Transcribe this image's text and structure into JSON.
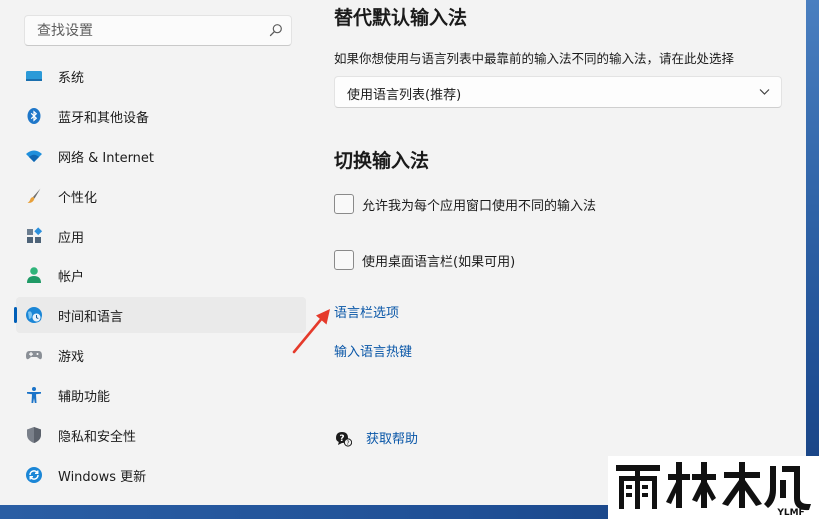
{
  "search": {
    "placeholder": "查找设置"
  },
  "sidebar": {
    "items": [
      {
        "label": "系统",
        "icon": "monitor-icon"
      },
      {
        "label": "蓝牙和其他设备",
        "icon": "bluetooth-icon"
      },
      {
        "label": "网络 & Internet",
        "icon": "wifi-icon"
      },
      {
        "label": "个性化",
        "icon": "brush-icon"
      },
      {
        "label": "应用",
        "icon": "apps-icon"
      },
      {
        "label": "帐户",
        "icon": "account-icon"
      },
      {
        "label": "时间和语言",
        "icon": "globe-clock-icon",
        "active": true
      },
      {
        "label": "游戏",
        "icon": "gamepad-icon"
      },
      {
        "label": "辅助功能",
        "icon": "accessibility-icon"
      },
      {
        "label": "隐私和安全性",
        "icon": "shield-icon"
      },
      {
        "label": "Windows 更新",
        "icon": "update-icon"
      }
    ]
  },
  "main": {
    "override_title": "替代默认输入法",
    "override_desc": "如果你想使用与语言列表中最靠前的输入法不同的输入法，请在此处选择",
    "override_select_value": "使用语言列表(推荐)",
    "switch_title": "切换输入法",
    "checkbox_per_app": {
      "label": "允许我为每个应用窗口使用不同的输入法",
      "checked": false
    },
    "checkbox_desktop_bar": {
      "label": "使用桌面语言栏(如果可用)",
      "checked": false
    },
    "link_language_bar_options": "语言栏选项",
    "link_input_hotkeys": "输入语言热键",
    "get_help": "获取帮助"
  },
  "watermark": {
    "text": "YLMF",
    "logo": "yulinmufeng-logo"
  },
  "colors": {
    "accent": "#005fb8",
    "link": "#0a57a8",
    "arrow": "#e53a2b"
  }
}
